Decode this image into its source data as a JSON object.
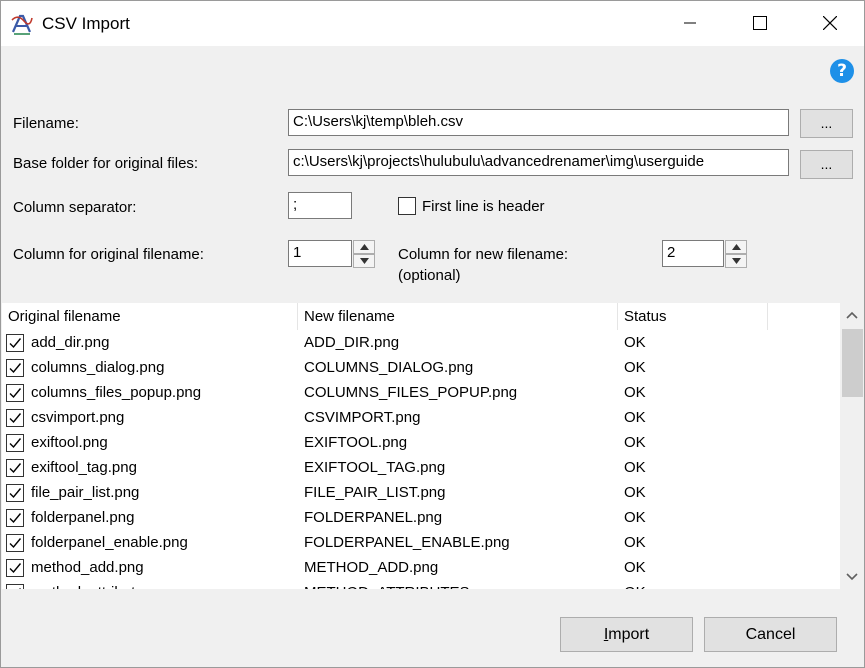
{
  "window": {
    "title": "CSV Import"
  },
  "form": {
    "filename_label": "Filename:",
    "filename_value": "C:\\Users\\kj\\temp\\bleh.csv",
    "browse_label": "...",
    "base_folder_label": "Base folder for original files:",
    "base_folder_value": "c:\\Users\\kj\\projects\\hulubulu\\advancedrenamer\\img\\userguide",
    "separator_label": "Column separator:",
    "separator_value": ";",
    "first_line_header_label": "First line is header",
    "first_line_header_checked": false,
    "orig_col_label": "Column for original filename:",
    "orig_col_value": "1",
    "new_col_label": "Column for new filename:",
    "new_col_optional": "(optional)",
    "new_col_value": "2"
  },
  "table": {
    "columns": [
      "Original filename",
      "New filename",
      "Status"
    ],
    "rows": [
      {
        "original": "add_dir.png",
        "new": "ADD_DIR.png",
        "status": "OK"
      },
      {
        "original": "columns_dialog.png",
        "new": "COLUMNS_DIALOG.png",
        "status": "OK"
      },
      {
        "original": "columns_files_popup.png",
        "new": "COLUMNS_FILES_POPUP.png",
        "status": "OK"
      },
      {
        "original": "csvimport.png",
        "new": "CSVIMPORT.png",
        "status": "OK"
      },
      {
        "original": "exiftool.png",
        "new": "EXIFTOOL.png",
        "status": "OK"
      },
      {
        "original": "exiftool_tag.png",
        "new": "EXIFTOOL_TAG.png",
        "status": "OK"
      },
      {
        "original": "file_pair_list.png",
        "new": "FILE_PAIR_LIST.png",
        "status": "OK"
      },
      {
        "original": "folderpanel.png",
        "new": "FOLDERPANEL.png",
        "status": "OK"
      },
      {
        "original": "folderpanel_enable.png",
        "new": "FOLDERPANEL_ENABLE.png",
        "status": "OK"
      },
      {
        "original": "method_add.png",
        "new": "METHOD_ADD.png",
        "status": "OK"
      },
      {
        "original": "method_attributes.png",
        "new": "METHOD_ATTRIBUTES.png",
        "status": "OK"
      }
    ]
  },
  "buttons": {
    "import_label": "Import",
    "cancel_label": "Cancel"
  },
  "colors": {
    "help_icon": "#1e90e8",
    "background": "#f0f0f0"
  }
}
